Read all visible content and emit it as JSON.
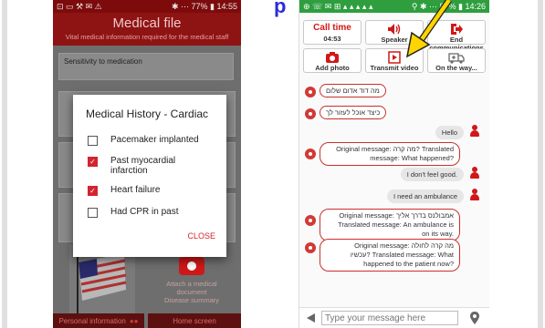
{
  "overlay_title_fragment": "p",
  "left_phone": {
    "status": {
      "left": "⊡ ▭ ⚒ ✉ ⚠",
      "right": "✱ ⋯ 77% ▮ 14:55"
    },
    "header": {
      "title": "Medical file",
      "subtitle": "Vital medical information required for the medical staff"
    },
    "sensitivity_label": "Sensitivity to medication",
    "dialog": {
      "title": "Medical History - Cardiac",
      "options": [
        {
          "label": "Pacemaker implanted",
          "checked": false
        },
        {
          "label": "Past myocardial infarction",
          "checked": true
        },
        {
          "label": "Heart failure",
          "checked": true
        },
        {
          "label": "Had CPR in past",
          "checked": false
        }
      ],
      "close_label": "CLOSE"
    },
    "camera_tile": {
      "line1": "Attach a medical",
      "line2": "document",
      "line3": "Disease summary"
    },
    "bottom": {
      "personal": "Personal information",
      "home": "Home screen"
    }
  },
  "right_phone": {
    "status": {
      "left": "⊕ ☏ ✉ ⊞ ▴ ▴ ▴ ▴ ▴",
      "right": "⚲ ✱ ⋯ 87% ▮ 14:26"
    },
    "buttons_row1": [
      {
        "label": "Call time",
        "value": "04:53",
        "icon": "timer"
      },
      {
        "label": "Speaker",
        "icon": "speaker-icon"
      },
      {
        "label": "End communications",
        "icon": "exit-icon"
      }
    ],
    "buttons_row2": [
      {
        "label": "Add photo",
        "icon": "camera-icon"
      },
      {
        "label": "Transmit video",
        "icon": "video-icon"
      },
      {
        "label": "On the way...",
        "icon": "ambulance-icon"
      }
    ],
    "messages": [
      {
        "text": "מה דוד אדום שלום",
        "dir": "out"
      },
      {
        "text": "כיצד אוכל לעזור לך",
        "dir": "out"
      },
      {
        "text": "Hello",
        "dir": "in"
      },
      {
        "line1": "Original message: מה קרה? Translated",
        "line2": "message: What happened?",
        "dir": "out"
      },
      {
        "text": "I don't feel good.",
        "dir": "in"
      },
      {
        "text": "I need an ambulance",
        "dir": "in"
      },
      {
        "line1": "Original message: אמבולנס בדרך אליך",
        "line2": "Translated message: An ambulance is",
        "line3": "on its way.",
        "dir": "out"
      },
      {
        "line1": "Original message: מה קרה לחולה",
        "line2": "עכשיו? Translated message: What",
        "line3": "happened to the patient now?",
        "dir": "out"
      }
    ],
    "input": {
      "placeholder": "Type your message here"
    }
  },
  "colors": {
    "accent": "#d01818",
    "arrow": "#ffd400",
    "left_header": "#8e1313",
    "status_green": "#2e9e3e"
  }
}
